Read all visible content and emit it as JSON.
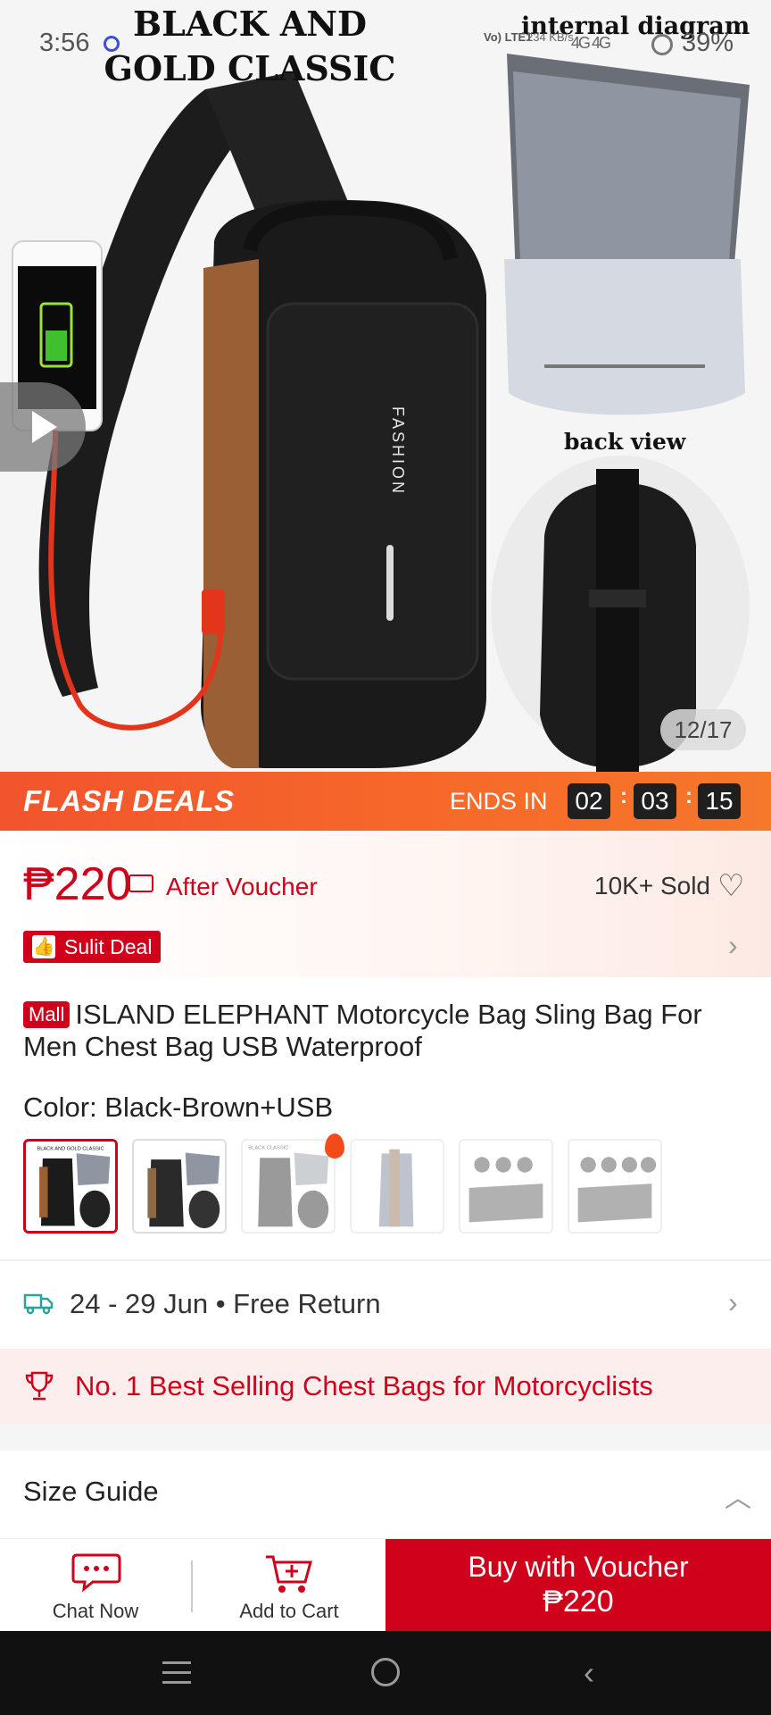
{
  "status_bar": {
    "time": "3:56",
    "network": "Vo) LTE1",
    "speed": "234 KB/s",
    "signal": "4G 4G",
    "battery": "39%"
  },
  "hero": {
    "title": "BLACK AND GOLD CLASSIC",
    "label_internal": "internal diagram",
    "label_back": "back view",
    "bag_print": "FASHION",
    "page_counter": "12/17"
  },
  "flash_deals": {
    "title": "FLASH DEALS",
    "ends_in_label": "ENDS IN",
    "hours": "02",
    "minutes": "03",
    "seconds": "15"
  },
  "price": {
    "amount": "₱220",
    "after_voucher": "After Voucher",
    "sold": "10K+ Sold",
    "badge": "Sulit Deal"
  },
  "product": {
    "mall_badge": "Mall",
    "title": "ISLAND ELEPHANT Motorcycle Bag Sling Bag For Men Chest Bag USB Waterproof",
    "color_label": "Color: Black-Brown+USB",
    "swatch_1_text": "BLACK AND GOLD CLASSIC",
    "swatch_3_text": "BLACK CLASSIC"
  },
  "delivery": {
    "text": "24 - 29 Jun • Free Return"
  },
  "best_selling": {
    "text": "No. 1 Best Selling Chest Bags for Motorcyclists"
  },
  "size_guide": {
    "label": "Size Guide"
  },
  "actions": {
    "chat": "Chat Now",
    "cart": "Add to Cart",
    "buy_line1": "Buy with Voucher",
    "buy_line2": "₱220"
  },
  "colors": {
    "accent": "#d0021b",
    "flash_orange": "#f2542d"
  }
}
